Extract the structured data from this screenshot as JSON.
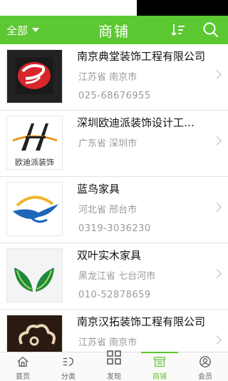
{
  "header": {
    "filter_label": "全部",
    "title": "商铺",
    "sort_icon": "sort-icon",
    "search_icon": "search-icon"
  },
  "shops": [
    {
      "name": "南京典堂装饰工程有限公司",
      "region": "江苏省 南京市",
      "phone": "025-68676955",
      "logo_icon": "dd-logo"
    },
    {
      "name": "深圳欧迪派装饰设计工程有限公司",
      "region": "广东省 深圳市",
      "phone": "",
      "logo_icon": "odp-logo",
      "logo_text": "欧迪派装饰"
    },
    {
      "name": "蓝鸟家具",
      "region": "河北省 邢台市",
      "phone": "0319-3036230",
      "logo_icon": "bluebird-logo"
    },
    {
      "name": "双叶实木家具",
      "region": "黑龙江省 七台河市",
      "phone": "010-52878659",
      "logo_icon": "leaves-logo"
    },
    {
      "name": "南京汉拓装饰工程有限公司",
      "region": "江苏省 南京市",
      "phone": "",
      "logo_icon": "cloud-logo"
    }
  ],
  "tabs": [
    {
      "label": "首页",
      "icon": "home-icon"
    },
    {
      "label": "分类",
      "icon": "category-icon"
    },
    {
      "label": "发现",
      "icon": "grid-icon"
    },
    {
      "label": "商铺",
      "icon": "shop-icon"
    },
    {
      "label": "会员",
      "icon": "member-icon"
    }
  ],
  "colors": {
    "accent": "#5cc832",
    "muted_text": "#9a9a9a"
  }
}
